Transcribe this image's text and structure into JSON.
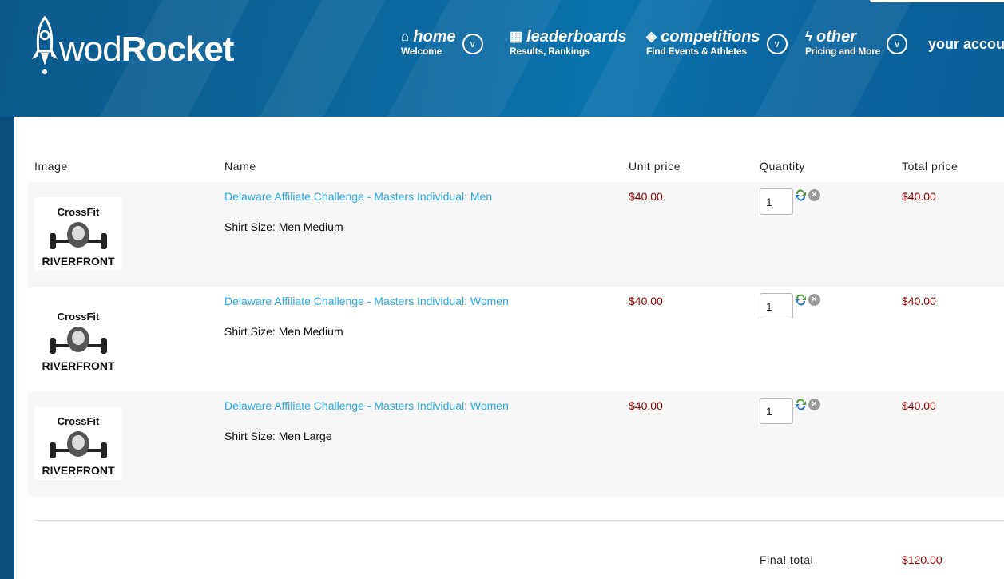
{
  "brand": {
    "name_light": "wod",
    "name_bold": "Rocket"
  },
  "nav": [
    {
      "label": "home",
      "sub": "Welcome",
      "icon": "home-icon"
    },
    {
      "label": "leaderboards",
      "sub": "Results, Rankings",
      "icon": "grid-icon"
    },
    {
      "label": "competitions",
      "sub": "Find Events & Athletes",
      "icon": "tag-icon"
    },
    {
      "label": "other",
      "sub": "Pricing and More",
      "icon": "bolt-icon"
    }
  ],
  "account_label": "your accou",
  "table": {
    "headers": [
      "Image",
      "Name",
      "Unit price",
      "Quantity",
      "Total price"
    ],
    "rows": [
      {
        "name": "Delaware Affiliate Challenge - Masters Individual: Men",
        "attribute": "Shirt Size: Men Medium",
        "unit_price": "$40.00",
        "quantity": "1",
        "total": "$40.00"
      },
      {
        "name": "Delaware Affiliate Challenge - Masters Individual: Women",
        "attribute": "Shirt Size: Men Medium",
        "unit_price": "$40.00",
        "quantity": "1",
        "total": "$40.00"
      },
      {
        "name": "Delaware Affiliate Challenge - Masters Individual: Women",
        "attribute": "Shirt Size: Men Large",
        "unit_price": "$40.00",
        "quantity": "1",
        "total": "$40.00"
      }
    ]
  },
  "thumbnail": {
    "line1": "CrossFit",
    "line2": "RIVERFRONT"
  },
  "final_total": {
    "label": "Final total",
    "value": "$120.00"
  },
  "colors": {
    "header": "#0c6aa3",
    "link": "#2aa7e0",
    "price": "#8b0000",
    "row_shade": "#f7f7f7"
  }
}
